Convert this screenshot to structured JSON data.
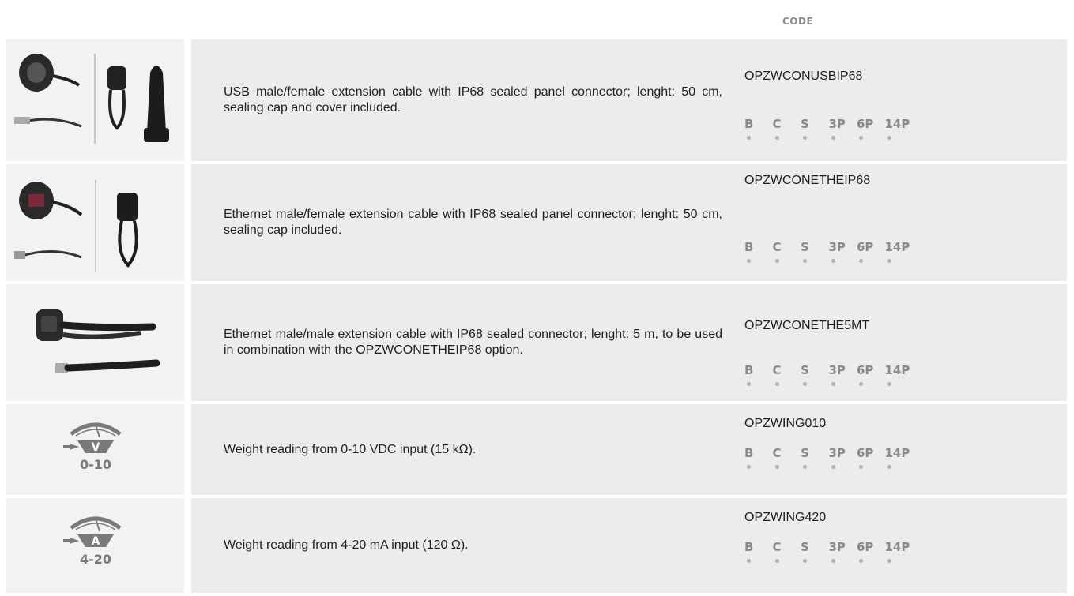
{
  "header": {
    "code_label": "CODE"
  },
  "rows": [
    {
      "description": "USB male/female extension cable with IP68 sealed panel connector; lenght: 50 cm, sealing cap and cover included.",
      "code": "OPZWCONUSBIP68",
      "models": [
        "B",
        "C",
        "S",
        "3P",
        "6P",
        "14P"
      ]
    },
    {
      "description": "Ethernet male/female extension cable with IP68 sealed panel connector; lenght: 50 cm, sealing cap included.",
      "code": "OPZWCONETHEIP68",
      "models": [
        "B",
        "C",
        "S",
        "3P",
        "6P",
        "14P"
      ]
    },
    {
      "description": "Ethernet male/male extension cable with IP68 sealed connector; lenght: 5 m, to be used in combination with the OPZWCONETHEIP68 option.",
      "code": "OPZWCONETHE5MT",
      "models": [
        "B",
        "C",
        "S",
        "3P",
        "6P",
        "14P"
      ]
    },
    {
      "description": "Weight reading from 0-10 VDC input (15 kΩ).",
      "code": "OPZWING010",
      "models": [
        "B",
        "C",
        "S",
        "3P",
        "6P",
        "14P"
      ],
      "icon_letter": "V",
      "icon_range": "0-10"
    },
    {
      "description": "Weight reading from 4-20 mA input (120 Ω).",
      "code": "OPZWING420",
      "models": [
        "B",
        "C",
        "S",
        "3P",
        "6P",
        "14P"
      ],
      "icon_letter": "A",
      "icon_range": "4-20"
    }
  ]
}
